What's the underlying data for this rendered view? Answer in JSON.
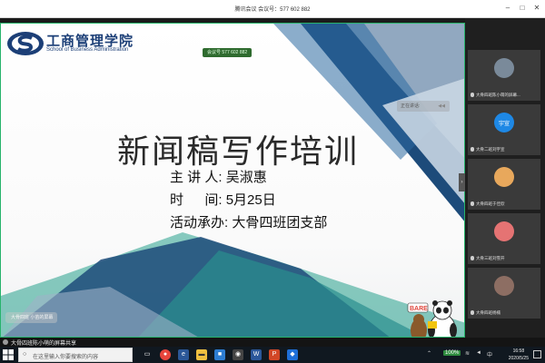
{
  "window": {
    "title": "腾讯会议 会议号：577 602 882"
  },
  "slide": {
    "school_cn": "工商管理学院",
    "school_en": "School of Business Administration",
    "meeting_badge": "会议号 577 602 882",
    "speaking_badge": "正在讲话:",
    "title": "新闻稿写作培训",
    "info": [
      {
        "label": "主 讲 人:",
        "value": "吴淑惠"
      },
      {
        "label": "时 　 间:",
        "value": "5月25日"
      },
      {
        "label": "活动承办:",
        "value": "大骨四班团支部"
      }
    ],
    "ghost_label": "大骨四班 小苗的屏幕"
  },
  "panel": {
    "speaking_label": "正在讲话:",
    "participants": [
      {
        "name": "大骨四班陈小萌的屏幕...",
        "avatar_text": "",
        "color": "#7a8a9a"
      },
      {
        "name": "大骨二班刘宇宣",
        "avatar_text": "宇宣",
        "color": "#1e88e5"
      },
      {
        "name": "大骨四班于佳欣",
        "avatar_text": "",
        "color": "#e8a85c"
      },
      {
        "name": "大骨三班刘雪开",
        "avatar_text": "",
        "color": "#e57373"
      },
      {
        "name": "大骨四班杨楠",
        "avatar_text": "",
        "color": "#8d6e63"
      }
    ]
  },
  "sharing_strip": {
    "text": "大骨四班陈小萌的屏幕共享"
  },
  "taskbar": {
    "search_placeholder": "在这里输入你要搜索的内容",
    "battery": "100%",
    "lang": "中",
    "time": "16:58",
    "date": "2020/5/25"
  }
}
